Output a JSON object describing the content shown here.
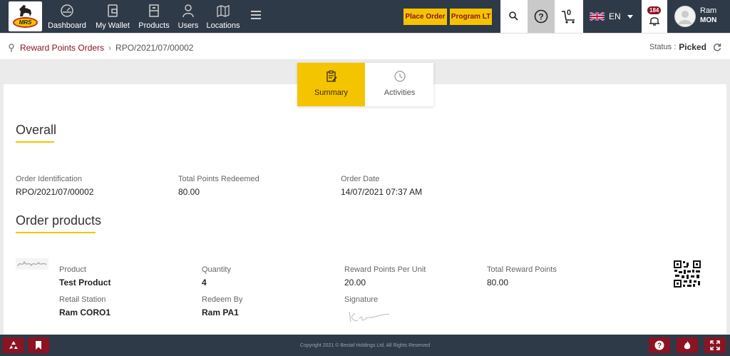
{
  "nav": {
    "logo_text": "MRS",
    "items": [
      {
        "label": "Dashboard"
      },
      {
        "label": "My Wallet"
      },
      {
        "label": "Products"
      },
      {
        "label": "Users"
      },
      {
        "label": "Locations"
      }
    ],
    "place_order": "Place Order",
    "program_lt": "Program LT",
    "cart_count": "0",
    "language": "EN",
    "notification_count": "184",
    "user_name": "Ram",
    "user_role": "MON"
  },
  "breadcrumb": {
    "parent": "Reward Points Orders",
    "current": "RPO/2021/07/00002",
    "status_label": "Status :",
    "status_value": "Picked"
  },
  "tabs": [
    {
      "label": "Summary",
      "active": true
    },
    {
      "label": "Activities",
      "active": false
    }
  ],
  "overall": {
    "title": "Overall",
    "fields": [
      {
        "label": "Order Identification",
        "value": "RPO/2021/07/00002"
      },
      {
        "label": "Total Points Redeemed",
        "value": "80.00"
      },
      {
        "label": "Order Date",
        "value": "14/07/2021 07:37 AM"
      }
    ]
  },
  "order_products": {
    "title": "Order products",
    "product": {
      "product_label": "Product",
      "product_value": "Test Product",
      "quantity_label": "Quantity",
      "quantity_value": "4",
      "rpu_label": "Reward Points Per Unit",
      "rpu_value": "20.00",
      "trp_label": "Total Reward Points",
      "trp_value": "80.00",
      "station_label": "Retail Station",
      "station_value": "Ram CORO1",
      "redeem_label": "Redeem By",
      "redeem_value": "Ram PA1",
      "signature_label": "Signature"
    }
  },
  "footer": {
    "copyright": "Copyright 2021 © Bestaf Holdings Ltd. All Rights Reserved"
  },
  "colors": {
    "navbar": "#2f3a48",
    "accent_yellow": "#f5c400",
    "brand_maroon": "#8b1322"
  }
}
